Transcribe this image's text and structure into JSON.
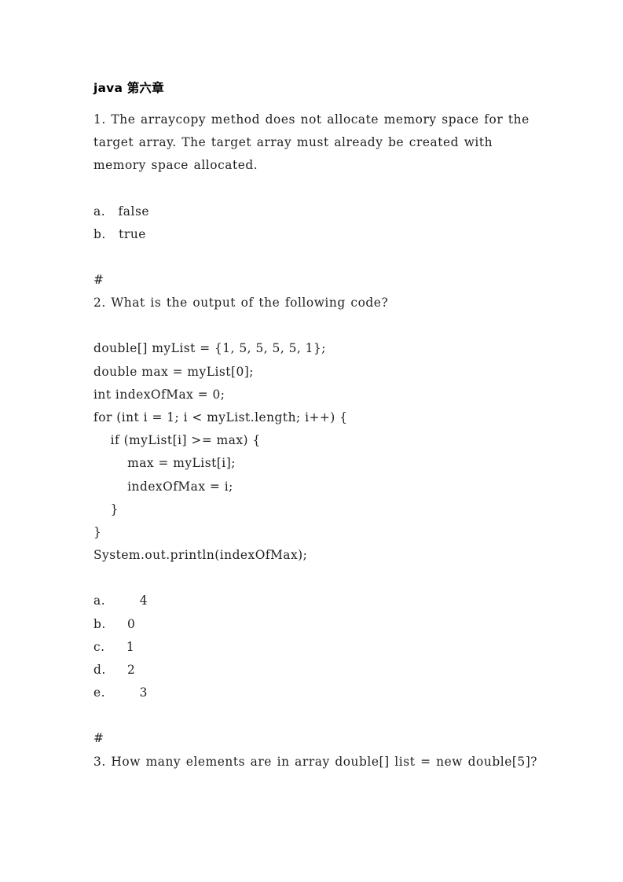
{
  "document": {
    "title": "java 第六章",
    "background_color": "#ffffff",
    "text_color": "#1f1f1f",
    "separator": "#",
    "blocks": [
      {
        "type": "question",
        "number": "1.",
        "text": "The arraycopy method does not allocate memory space for the target array. The target array must already be created with memory space allocated."
      },
      {
        "type": "options",
        "items": [
          {
            "label": "a.",
            "value": "false",
            "indent": "normal"
          },
          {
            "label": "b.",
            "value": "true",
            "indent": "normal"
          }
        ]
      },
      {
        "type": "separator",
        "text": "#"
      },
      {
        "type": "question",
        "number": "2.",
        "text": "What is the output of the following code?"
      },
      {
        "type": "code",
        "lines": [
          "double[] myList = {1, 5, 5, 5, 5, 1};",
          "double max = myList[0];",
          "int indexOfMax = 0;",
          "for (int i = 1; i < myList.length; i++) {",
          "    if (myList[i] >= max) {",
          "        max = myList[i];",
          "        indexOfMax = i;",
          "    }",
          "}",
          "System.out.println(indexOfMax);"
        ]
      },
      {
        "type": "options",
        "items": [
          {
            "label": "a.",
            "value": "4",
            "indent": "wide"
          },
          {
            "label": "b.",
            "value": "0",
            "indent": "normal"
          },
          {
            "label": "c.",
            "value": "1",
            "indent": "normal"
          },
          {
            "label": "d.",
            "value": "2",
            "indent": "normal"
          },
          {
            "label": "e.",
            "value": "3",
            "indent": "wide"
          }
        ]
      },
      {
        "type": "separator",
        "text": "#"
      },
      {
        "type": "question",
        "number": "3.",
        "text": "How many elements are in array double[] list = new double[5]?"
      }
    ]
  },
  "q1": {
    "number": "1.",
    "body": "The arraycopy method does not allocate memory space for the target array. The target array must already be created with memory space allocated.",
    "full_line": "1.      The arraycopy method does not allocate memory space for the target array. The target array must already be created with memory space allocated.",
    "options": {
      "a": "a.   false",
      "b": "b.   true"
    }
  },
  "sep1": "#",
  "q2": {
    "full_line": "2.  What is the output of the following code?",
    "code": {
      "l1": "double[] myList = {1, 5, 5, 5, 5, 1};",
      "l2": "double max = myList[0];",
      "l3": "int indexOfMax = 0;",
      "l4": "for (int i = 1; i < myList.length; i++) {",
      "l5": "    if (myList[i] >= max) {",
      "l6": "        max = myList[i];",
      "l7": "        indexOfMax = i;",
      "l8": "    }",
      "l9": "}",
      "l10": "System.out.println(indexOfMax);"
    },
    "options": {
      "a": "a.        4",
      "b": "b.     0",
      "c": "c.     1",
      "d": "d.     2",
      "e": "e.        3"
    }
  },
  "sep2": "#",
  "q3": {
    "full_line": "3.  How many elements are in array double[] list = new double[5]?"
  }
}
